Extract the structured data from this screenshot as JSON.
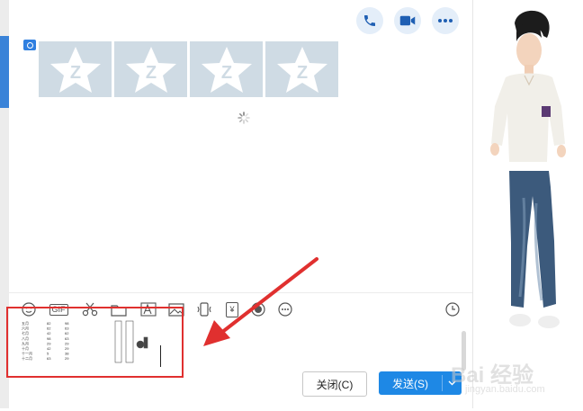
{
  "buttons": {
    "close": "关闭(C)",
    "send": "发送(S)"
  },
  "icons": {
    "call": "phone-icon",
    "video": "video-camera-icon",
    "more": "more-dots-icon",
    "loading": "loading-spinner-icon",
    "history": "clock-icon"
  },
  "toolbar": {
    "items": [
      {
        "name": "emoji-icon"
      },
      {
        "name": "gif-icon",
        "label": "GIF"
      },
      {
        "name": "scissors-icon"
      },
      {
        "name": "folder-icon"
      },
      {
        "name": "font-icon"
      },
      {
        "name": "image-icon"
      },
      {
        "name": "shake-icon"
      },
      {
        "name": "red-packet-icon",
        "label": "¥"
      },
      {
        "name": "music-icon"
      },
      {
        "name": "more-options-icon"
      }
    ]
  },
  "pasted_table": {
    "months": [
      "五月",
      "六月",
      "七月",
      "八月",
      "九月",
      "十月",
      "十一月",
      "十二月"
    ],
    "col_a": [
      "82",
      "62",
      "42",
      "98",
      "29",
      "42",
      "5",
      "63"
    ],
    "col_b": [
      "98",
      "63",
      "62",
      "63",
      "29",
      "29",
      "38",
      "29"
    ]
  },
  "colors": {
    "accent": "#1e88e5",
    "annotation": "#e0302f",
    "image_placeholder": "#cfdbe4"
  },
  "watermark": {
    "line1": "Bai 经验",
    "line2": "jingyan.baidu.com"
  }
}
